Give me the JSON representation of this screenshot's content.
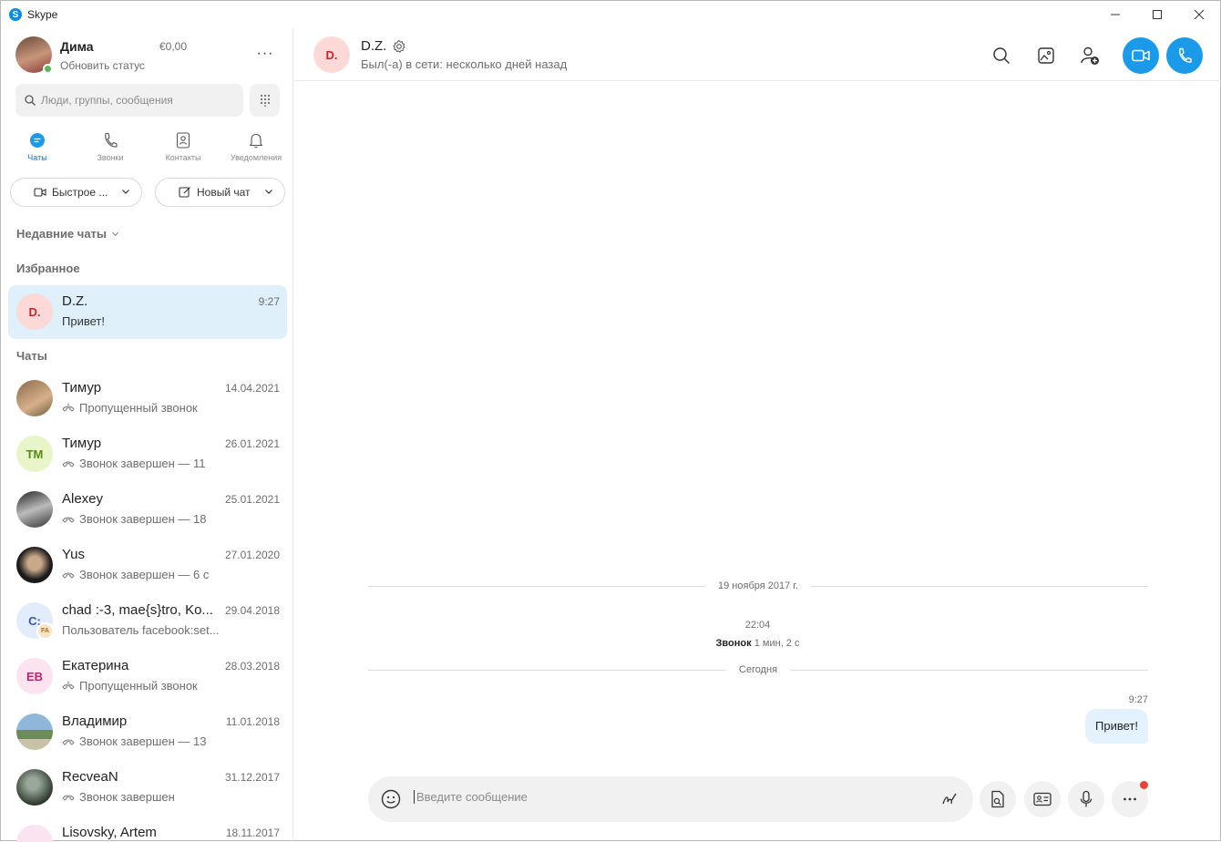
{
  "window": {
    "title": "Skype"
  },
  "profile": {
    "name": "Дима",
    "status_prompt": "Обновить статус",
    "balance": "€0,00",
    "more": "···"
  },
  "search": {
    "placeholder": "Люди, группы, сообщения"
  },
  "tabs": [
    {
      "label": "Чаты",
      "active": true
    },
    {
      "label": "Звонки"
    },
    {
      "label": "Контакты"
    },
    {
      "label": "Уведомления"
    }
  ],
  "actions": {
    "meet_now": "Быстрое ...",
    "new_chat": "Новый чат"
  },
  "sections": {
    "recent": "Недавние чаты",
    "favorites": "Избранное",
    "chats": "Чаты"
  },
  "favorites": [
    {
      "name": "D.Z.",
      "initials": "D.",
      "time": "9:27",
      "last": "Привет!"
    }
  ],
  "chats": [
    {
      "name": "Тимур",
      "time": "14.04.2021",
      "last": "Пропущенный звонок",
      "icon": "missed-call-icon"
    },
    {
      "name": "Тимур",
      "initials": "TM",
      "time": "26.01.2021",
      "last": "Звонок завершен — 11",
      "icon": "call-ended-icon"
    },
    {
      "name": "Alexey",
      "time": "25.01.2021",
      "last": "Звонок завершен — 18",
      "icon": "call-ended-icon"
    },
    {
      "name": "Yus",
      "time": "27.01.2020",
      "last": "Звонок завершен — 6 с",
      "icon": "call-ended-icon"
    },
    {
      "name": "chad :-3, mae{s}tro, Ko...",
      "initials": "C:",
      "badge": "FA",
      "time": "29.04.2018",
      "last": "Пользователь facebook:set..."
    },
    {
      "name": "Екатерина",
      "initials": "ЕВ",
      "time": "28.03.2018",
      "last": "Пропущенный звонок",
      "icon": "missed-call-icon"
    },
    {
      "name": "Владимир",
      "time": "11.01.2018",
      "last": "Звонок завершен — 13",
      "icon": "call-ended-icon"
    },
    {
      "name": "RecveaN",
      "time": "31.12.2017",
      "last": "Звонок завершен",
      "icon": "call-ended-icon"
    },
    {
      "name": "Lisovsky, Artem",
      "time": "18.11.2017",
      "last": ""
    }
  ],
  "conversation": {
    "name": "D.Z.",
    "initials": "D.",
    "status": "Был(-а) в сети: несколько дней назад",
    "date_divider_1": "19 ноября 2017 г.",
    "call_time": "22:04",
    "call_label": "Звонок",
    "call_duration": "1 мин, 2 с",
    "date_divider_2": "Сегодня",
    "message_time": "9:27",
    "message_text": "Привет!"
  },
  "composer": {
    "placeholder": "Введите сообщение"
  },
  "colors": {
    "accent": "#1a9ae8",
    "active_row": "#dff0fb",
    "online": "#5cb85c",
    "notify": "#e8413c"
  }
}
